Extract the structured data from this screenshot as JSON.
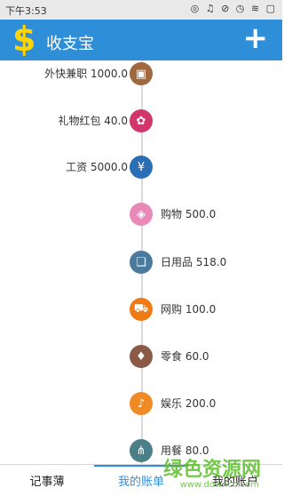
{
  "status": {
    "time": "下午3:53",
    "icons": "◎ ♫ ⊘ ◷ ≋ ▢"
  },
  "header": {
    "logo": "$",
    "title": "收支宝",
    "add_label": "+"
  },
  "entries": [
    {
      "side": "left",
      "label": "外快兼职",
      "amount": "1000.0",
      "icon": "wallet-icon",
      "glyph": "▣",
      "color": "#a0683f"
    },
    {
      "side": "left",
      "label": "礼物红包",
      "amount": "40.0",
      "icon": "gift-icon",
      "glyph": "✿",
      "color": "#d0366a"
    },
    {
      "side": "left",
      "label": "工资",
      "amount": "5000.0",
      "icon": "yen-icon",
      "glyph": "¥",
      "color": "#2a6fb6"
    },
    {
      "side": "right",
      "label": "购物",
      "amount": "500.0",
      "icon": "shopping-bag-icon",
      "glyph": "◈",
      "color": "#e889b8"
    },
    {
      "side": "right",
      "label": "日用品",
      "amount": "518.0",
      "icon": "daily-goods-icon",
      "glyph": "❑",
      "color": "#4a7a9e"
    },
    {
      "side": "right",
      "label": "网购",
      "amount": "100.0",
      "icon": "cart-icon",
      "glyph": "⛟",
      "color": "#f07b15"
    },
    {
      "side": "right",
      "label": "零食",
      "amount": "60.0",
      "icon": "ice-cream-icon",
      "glyph": "♦",
      "color": "#8a5a47"
    },
    {
      "side": "right",
      "label": "娱乐",
      "amount": "200.0",
      "icon": "microphone-icon",
      "glyph": "♪",
      "color": "#f08a25"
    },
    {
      "side": "right",
      "label": "用餐",
      "amount": "80.0",
      "icon": "cutlery-icon",
      "glyph": "⋔",
      "color": "#4a7f88"
    }
  ],
  "tabs": [
    {
      "label": "记事薄",
      "active": false
    },
    {
      "label": "我的账单",
      "active": true
    },
    {
      "label": "我的账户",
      "active": false
    }
  ],
  "watermark": {
    "text": "绿色资源网",
    "url": "www.downcc.com"
  }
}
